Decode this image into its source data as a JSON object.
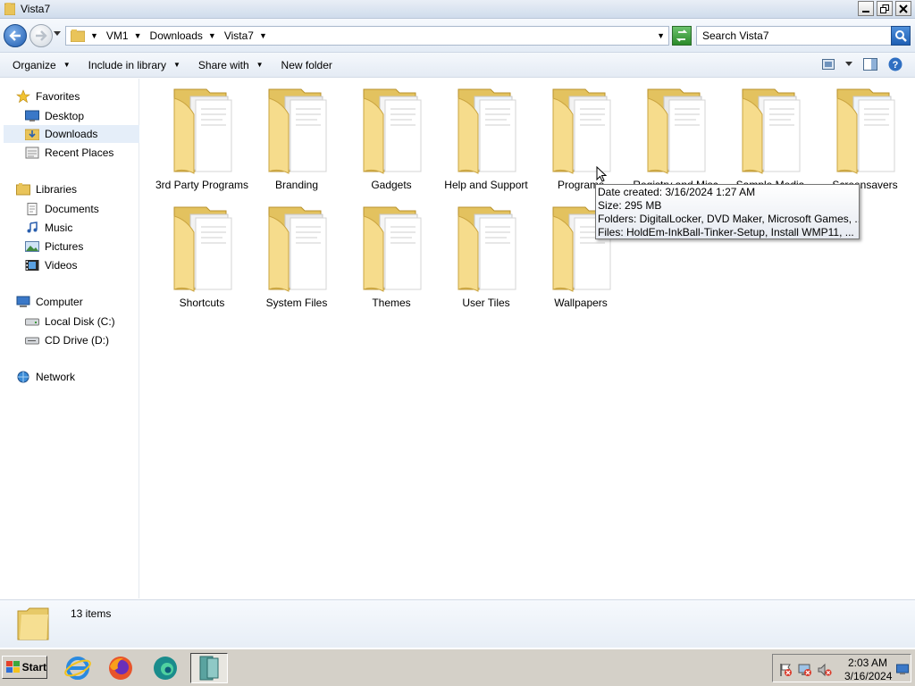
{
  "window": {
    "title": "Vista7"
  },
  "address": {
    "crumbs": [
      {
        "label": "VM1"
      },
      {
        "label": "Downloads"
      },
      {
        "label": "Vista7"
      }
    ]
  },
  "search": {
    "placeholder": "Search Vista7"
  },
  "toolbar": {
    "organize": "Organize",
    "include_in_library": "Include in library",
    "share_with": "Share with",
    "new_folder": "New folder"
  },
  "navigation": {
    "favorites": {
      "label": "Favorites",
      "items": [
        "Desktop",
        "Downloads",
        "Recent Places"
      ],
      "selected": "Downloads"
    },
    "libraries": {
      "label": "Libraries",
      "items": [
        "Documents",
        "Music",
        "Pictures",
        "Videos"
      ]
    },
    "computer": {
      "label": "Computer",
      "items": [
        "Local Disk (C:)",
        "CD Drive (D:)"
      ]
    },
    "network": {
      "label": "Network"
    }
  },
  "folders": [
    {
      "name": "3rd Party Programs"
    },
    {
      "name": "Branding"
    },
    {
      "name": "Gadgets"
    },
    {
      "name": "Help and Support"
    },
    {
      "name": "Programs"
    },
    {
      "name": "Registry and Misc"
    },
    {
      "name": "Sample Media"
    },
    {
      "name": "Screensavers"
    },
    {
      "name": "Shortcuts"
    },
    {
      "name": "System Files"
    },
    {
      "name": "Themes"
    },
    {
      "name": "User Tiles"
    },
    {
      "name": "Wallpapers"
    }
  ],
  "tooltip": {
    "date_created": "Date created: 3/16/2024 1:27 AM",
    "size": "Size: 295 MB",
    "folders": "Folders: DigitalLocker, DVD Maker, Microsoft Games, ...",
    "files": "Files: HoldEm-InkBall-Tinker-Setup, Install WMP11, ..."
  },
  "status": {
    "item_count": "13 items"
  },
  "taskbar": {
    "start_label": "Start",
    "clock_time": "2:03 AM",
    "clock_date": "3/16/2024"
  },
  "colors": {
    "folder_yellow": "#f3d98a",
    "selection_bg": "#e5eef9",
    "accent_blue": "#1e5cb0"
  }
}
